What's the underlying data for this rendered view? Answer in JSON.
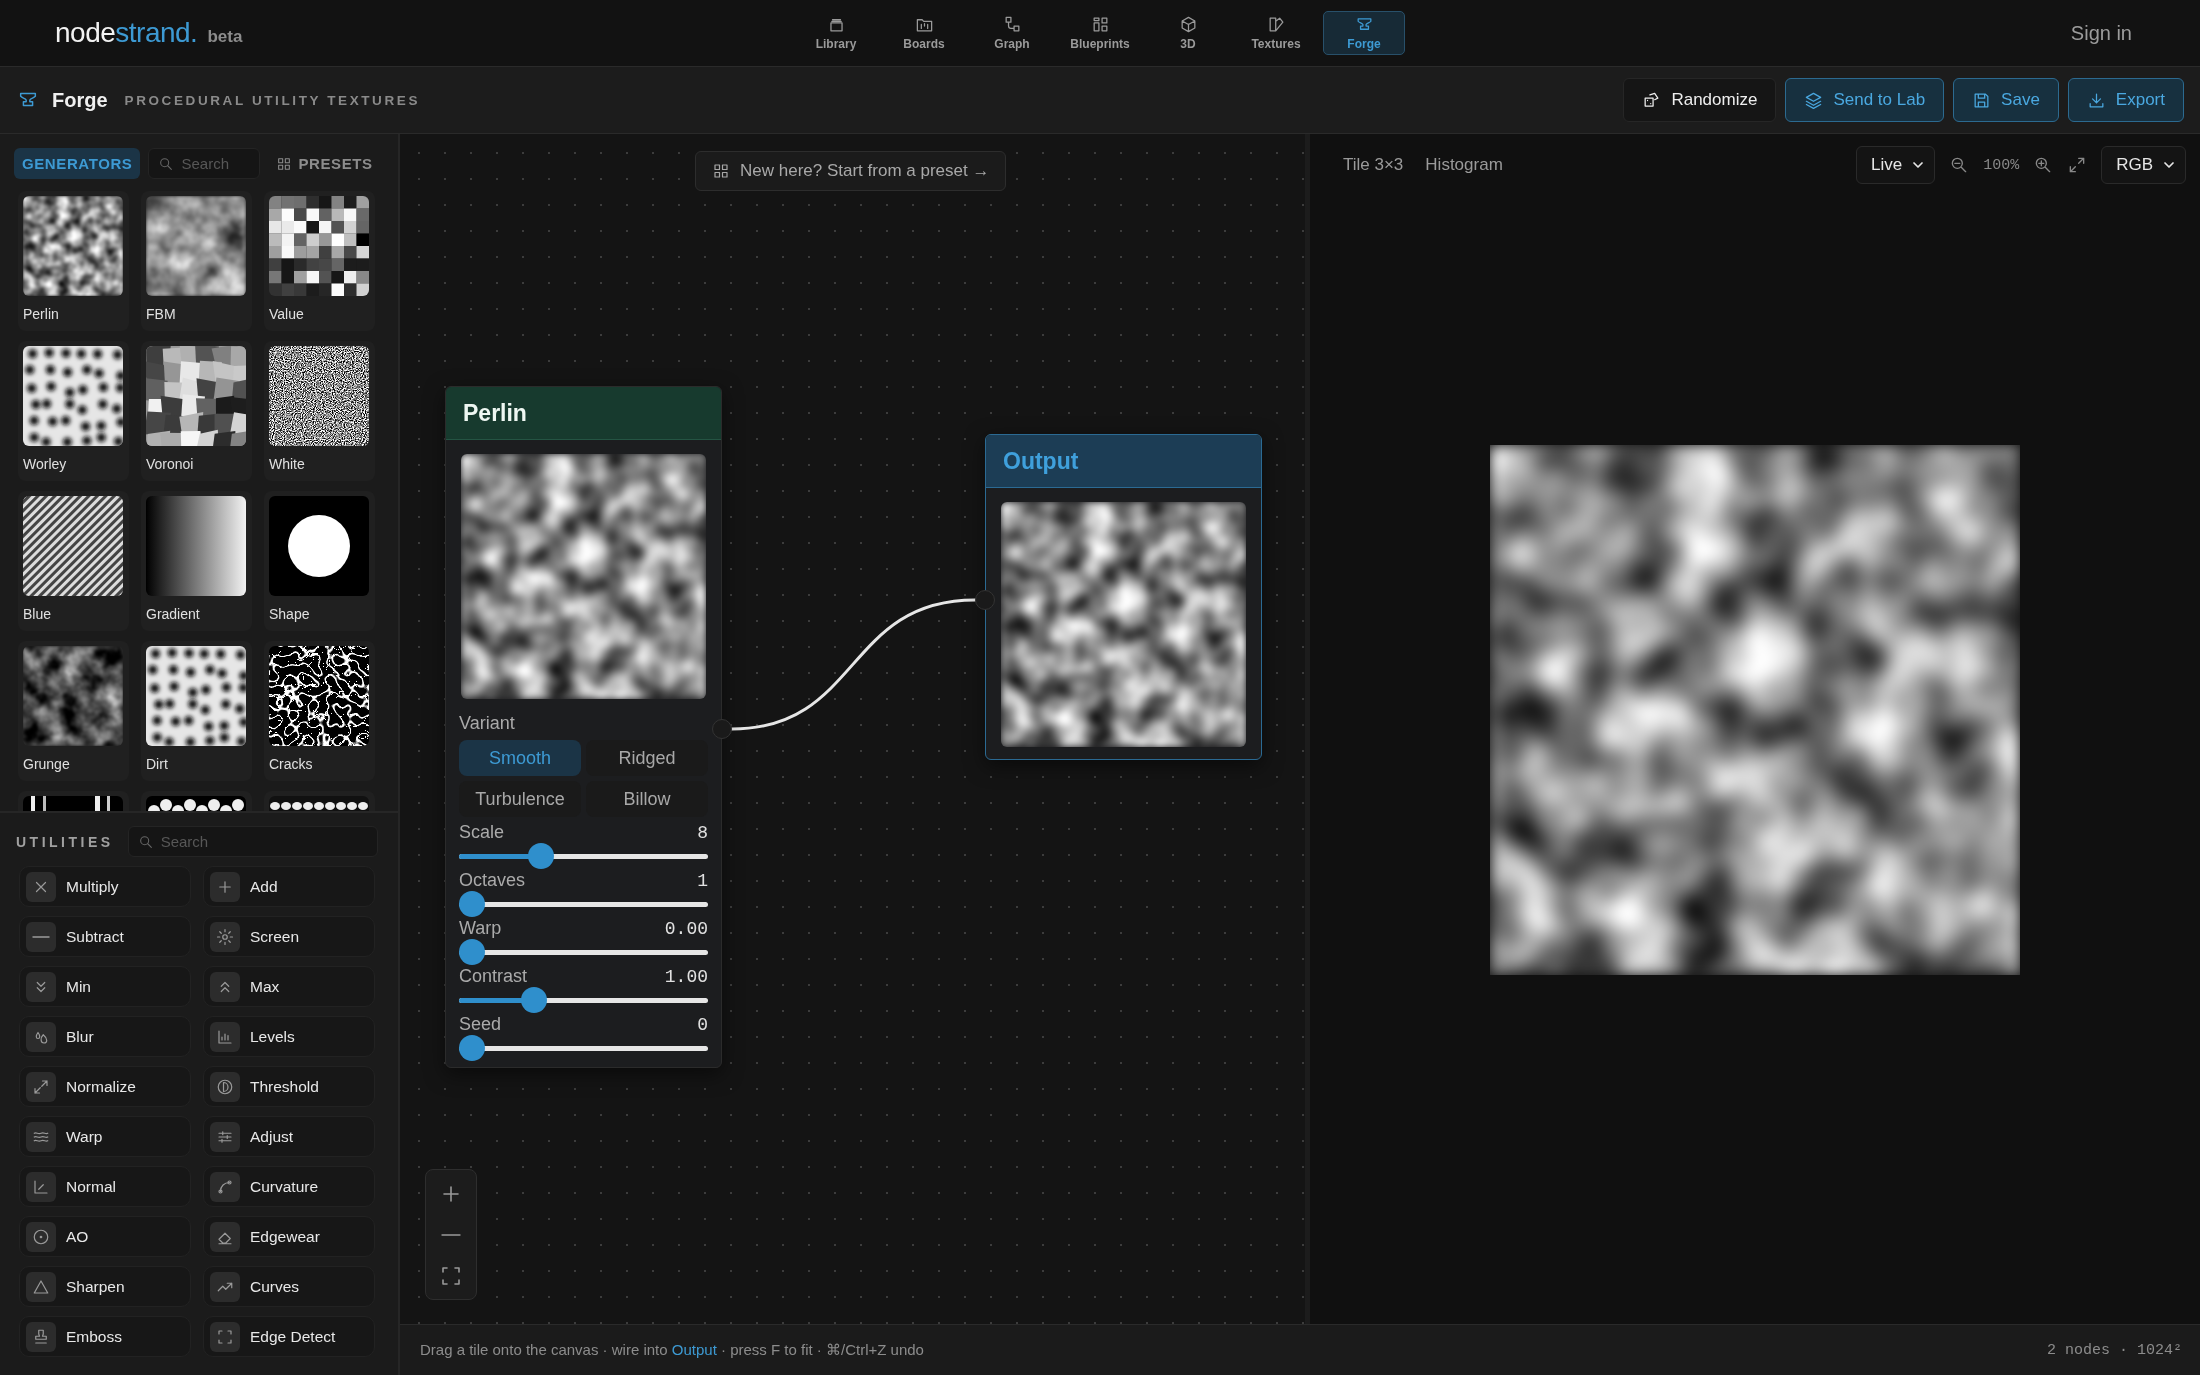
{
  "top_bar": {
    "logo": {
      "main": "node",
      "accent": "strand."
    },
    "badge": "beta",
    "nav": [
      {
        "label": "Library",
        "selected": false
      },
      {
        "label": "Boards",
        "selected": false
      },
      {
        "label": "Graph",
        "selected": false
      },
      {
        "label": "Blueprints",
        "selected": false
      },
      {
        "label": "3D",
        "selected": false
      },
      {
        "label": "Textures",
        "selected": false
      },
      {
        "label": "Forge",
        "selected": true
      }
    ],
    "sign_in": "Sign in"
  },
  "header": {
    "title": "Forge",
    "subtitle": "PROCEDURAL UTILITY TEXTURES",
    "actions": [
      {
        "label": "Randomize",
        "kind": "plain"
      },
      {
        "label": "Send to Lab",
        "kind": "accent"
      },
      {
        "label": "Save",
        "kind": "accent"
      },
      {
        "label": "Export",
        "kind": "accent"
      }
    ]
  },
  "sidebar": {
    "tabs": [
      {
        "label": "GENERATORS",
        "selected": true
      },
      {
        "label": "PRESETS",
        "selected": false
      }
    ],
    "search": {
      "placeholder": "Search"
    },
    "generators": [
      {
        "label": "Perlin"
      },
      {
        "label": "FBM"
      },
      {
        "label": "Value"
      },
      {
        "label": "Worley"
      },
      {
        "label": "Voronoi"
      },
      {
        "label": "White"
      },
      {
        "label": "Blue"
      },
      {
        "label": "Gradient"
      },
      {
        "label": "Shape"
      },
      {
        "label": "Grunge"
      },
      {
        "label": "Dirt"
      },
      {
        "label": "Cracks"
      }
    ],
    "utilities": {
      "title": "UTILITIES",
      "search": {
        "placeholder": "Search"
      },
      "items": [
        {
          "label": "Multiply"
        },
        {
          "label": "Add"
        },
        {
          "label": "Subtract"
        },
        {
          "label": "Screen"
        },
        {
          "label": "Min"
        },
        {
          "label": "Max"
        },
        {
          "label": "Blur"
        },
        {
          "label": "Levels"
        },
        {
          "label": "Normalize"
        },
        {
          "label": "Threshold"
        },
        {
          "label": "Warp"
        },
        {
          "label": "Adjust"
        },
        {
          "label": "Normal"
        },
        {
          "label": "Curvature"
        },
        {
          "label": "AO"
        },
        {
          "label": "Edgewear"
        },
        {
          "label": "Sharpen"
        },
        {
          "label": "Curves"
        },
        {
          "label": "Emboss"
        },
        {
          "label": "Edge Detect"
        }
      ]
    }
  },
  "canvas": {
    "hint": "New here? Start from a preset →",
    "perlin_node": {
      "title": "Perlin",
      "variant_label": "Variant",
      "variants": [
        {
          "label": "Smooth",
          "selected": true
        },
        {
          "label": "Ridged",
          "selected": false
        },
        {
          "label": "Turbulence",
          "selected": false
        },
        {
          "label": "Billow",
          "selected": false
        }
      ],
      "sliders": [
        {
          "label": "Scale",
          "value": "8",
          "level": 0.33
        },
        {
          "label": "Octaves",
          "value": "1",
          "level": 0
        },
        {
          "label": "Warp",
          "value": "0.00",
          "level": 0
        },
        {
          "label": "Contrast",
          "value": "1.00",
          "level": 0.3
        },
        {
          "label": "Seed",
          "value": "0",
          "level": 0
        }
      ]
    },
    "output_node": {
      "title": "Output"
    }
  },
  "preview": {
    "tabs": [
      "Tile 3×3",
      "Histogram"
    ],
    "mode": "Live",
    "zoom": "100%",
    "channel": "RGB"
  },
  "status_bar": {
    "hint_before": "Drag a tile onto the canvas · wire into",
    "hint_link": "Output",
    "hint_after": "· press F to fit · ⌘/Ctrl+Z undo",
    "info": "2 nodes · 1024²"
  }
}
